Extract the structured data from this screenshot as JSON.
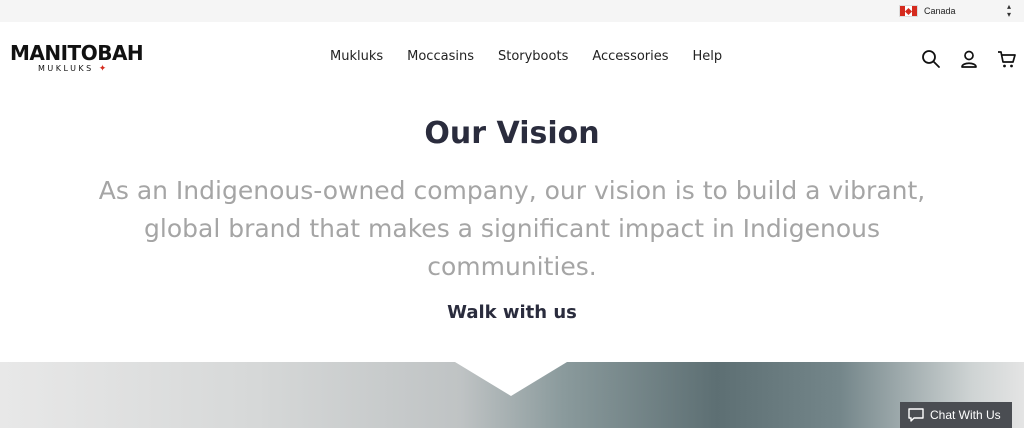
{
  "topbar": {
    "country_label": "Canada",
    "flag_icon": "canada-flag-icon"
  },
  "header": {
    "logo_main": "MANITOBAH",
    "logo_sub": "MUKLUKS",
    "nav": [
      {
        "label": "Mukluks"
      },
      {
        "label": "Moccasins"
      },
      {
        "label": "Storyboots"
      },
      {
        "label": "Accessories"
      },
      {
        "label": "Help"
      }
    ],
    "icons": [
      "search-icon",
      "account-icon",
      "cart-icon"
    ]
  },
  "vision": {
    "title": "Our Vision",
    "text": "As an Indigenous-owned company, our vision is to build a vibrant, global brand that makes a significant impact in Indigenous communities.",
    "cta": "Walk with us"
  },
  "chat": {
    "label": "Chat With Us",
    "icon": "chat-bubble-icon"
  },
  "colors": {
    "title": "#2a2c3d",
    "body_text": "#a5a5a5",
    "brand_red": "#d52b1e",
    "chat_bg": "#4a4d52"
  }
}
